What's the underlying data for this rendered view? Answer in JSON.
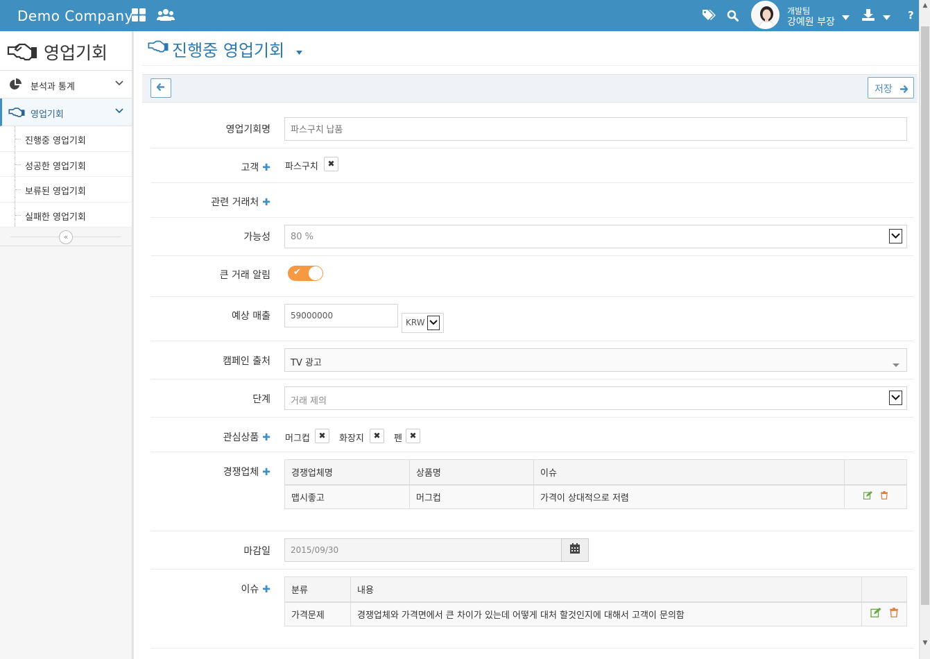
{
  "topbar": {
    "brand": "Demo Company",
    "icons": [
      "grid-icon",
      "users-icon",
      "tags-icon",
      "search-icon",
      "download-icon",
      "help-icon"
    ],
    "user": {
      "dept": "개발팀",
      "name": "강예원 부장"
    },
    "help": "?"
  },
  "sidebar": {
    "title": "영업기회",
    "items": [
      {
        "label": "분석과 통계",
        "icon": "pie-chart-icon"
      },
      {
        "label": "영업기회",
        "icon": "handshake-icon",
        "active": true
      }
    ],
    "subitems": [
      "진행중 영업기회",
      "성공한 영업기회",
      "보류된 영업기회",
      "실패한 영업기회"
    ]
  },
  "page": {
    "title": "진행중 영업기회",
    "save_label": "저장"
  },
  "form": {
    "name_label": "영업기회명",
    "name_placeholder": "파스구치 납품",
    "customer_label": "고객",
    "customer_tag": "파스구치",
    "partner_label": "관련 거래처",
    "probability_label": "가능성",
    "probability_value": "80 %",
    "alert_label": "큰 거래 알림",
    "alert_on": true,
    "revenue_label": "예상 매출",
    "revenue_value": "59000000",
    "currency": "KRW",
    "campaign_label": "캠페인 출처",
    "campaign_value": "TV 광고",
    "stage_label": "단계",
    "stage_value": "거래 제의",
    "products_label": "관심상품",
    "products": [
      "머그컵",
      "화장지",
      "펜"
    ],
    "competitors_label": "경쟁업체",
    "competitors_headers": [
      "경쟁업체명",
      "상품명",
      "이슈"
    ],
    "competitors_rows": [
      [
        "맵시좋고",
        "머그컵",
        "가격이 상대적으로 저렴"
      ]
    ],
    "deadline_label": "마감일",
    "deadline_value": "2015/09/30",
    "issues_label": "이슈",
    "issues_headers": [
      "분류",
      "내용"
    ],
    "issues_rows": [
      [
        "가격문제",
        "경쟁업체와 가격면에서 큰 차이가 있는데 어떻게 대처 할것인지에 대해서 고객이 문의함"
      ]
    ]
  },
  "colors": {
    "brand": "#3f8fc0",
    "accent": "#f59942",
    "link": "#2a7ab5"
  }
}
